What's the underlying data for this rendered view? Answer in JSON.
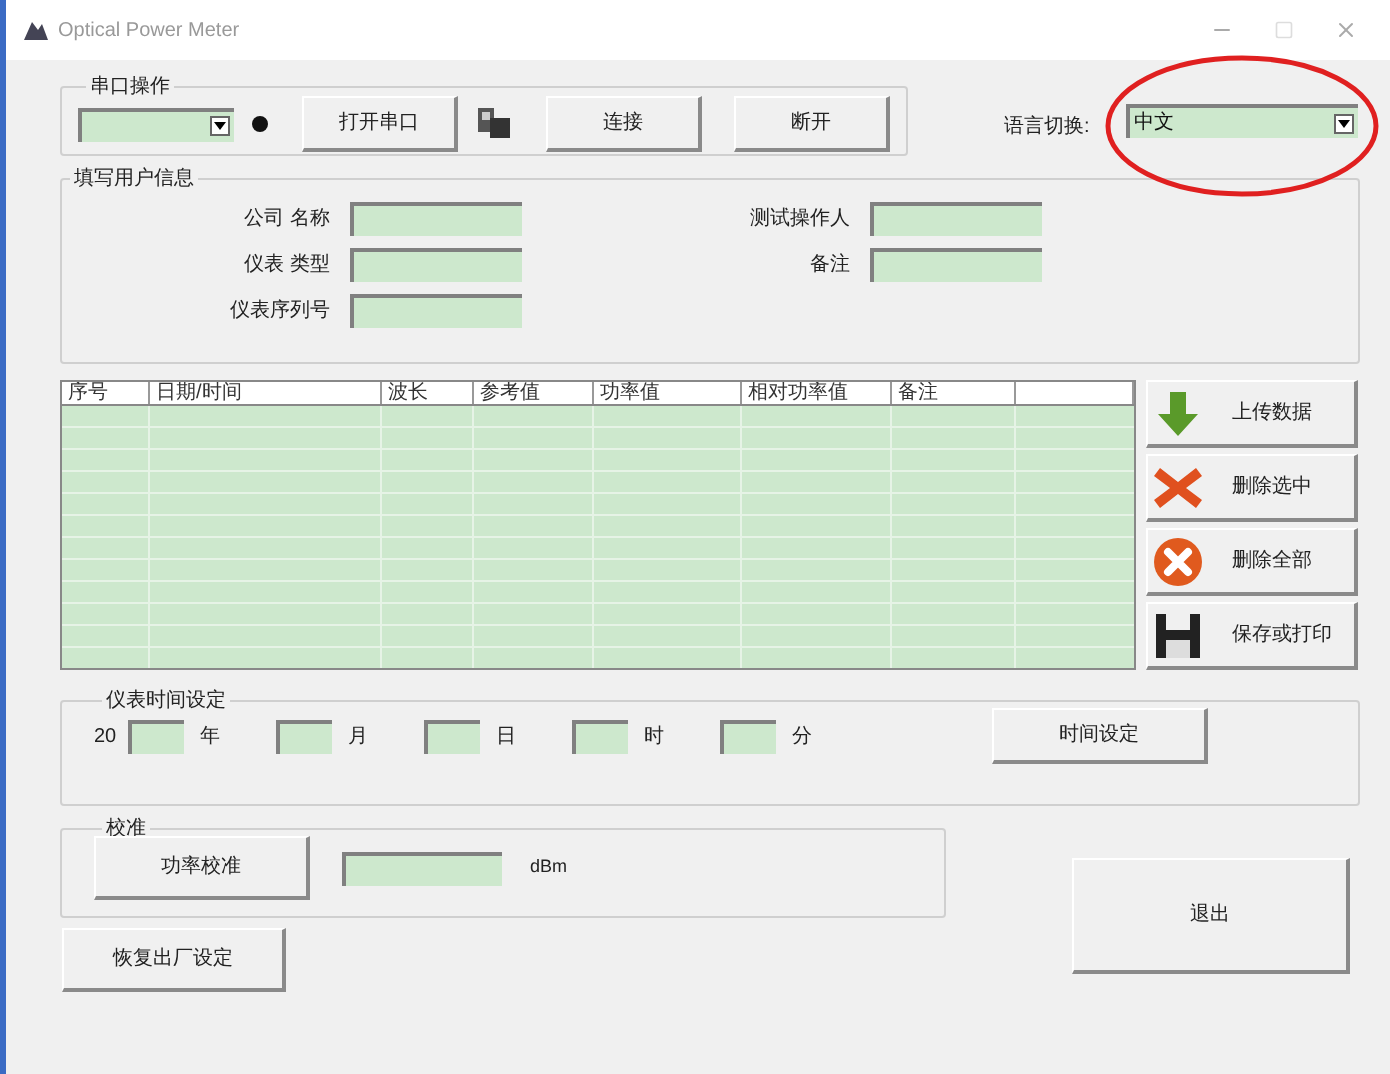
{
  "window": {
    "title": "Optical Power Meter"
  },
  "serial": {
    "title": "串口操作",
    "buttons": [
      "打开串口",
      "连接",
      "断开"
    ]
  },
  "language": {
    "label": "语言切换:",
    "value": "中文",
    "circled": true
  },
  "user_info": {
    "title": "填写用户信息",
    "left_fields": [
      {
        "label": "公司 名称"
      },
      {
        "label": "仪表 类型"
      },
      {
        "label": "仪表序列号"
      }
    ],
    "right_fields": [
      {
        "label": "测试操作人"
      },
      {
        "label": "备注"
      }
    ]
  },
  "table": {
    "columns": [
      "序号",
      "日期/时间",
      "波长",
      "参考值",
      "功率值",
      "相对功率值",
      "备注"
    ]
  },
  "actions": [
    {
      "label": "上传数据",
      "kind": "upload"
    },
    {
      "label": "删除选中",
      "kind": "delete"
    },
    {
      "label": "删除全部",
      "kind": "clear"
    },
    {
      "label": "保存或打印",
      "kind": "save"
    }
  ],
  "time": {
    "title": "仪表时间设定",
    "prefix": "20",
    "units": [
      "年",
      "月",
      "日",
      "时",
      "分"
    ],
    "button": "时间设定"
  },
  "calibration": {
    "title": "校准",
    "button": "功率校准",
    "unit": "dBm"
  },
  "restore_button": "恢复出厂设定",
  "exit_button": "退出"
}
